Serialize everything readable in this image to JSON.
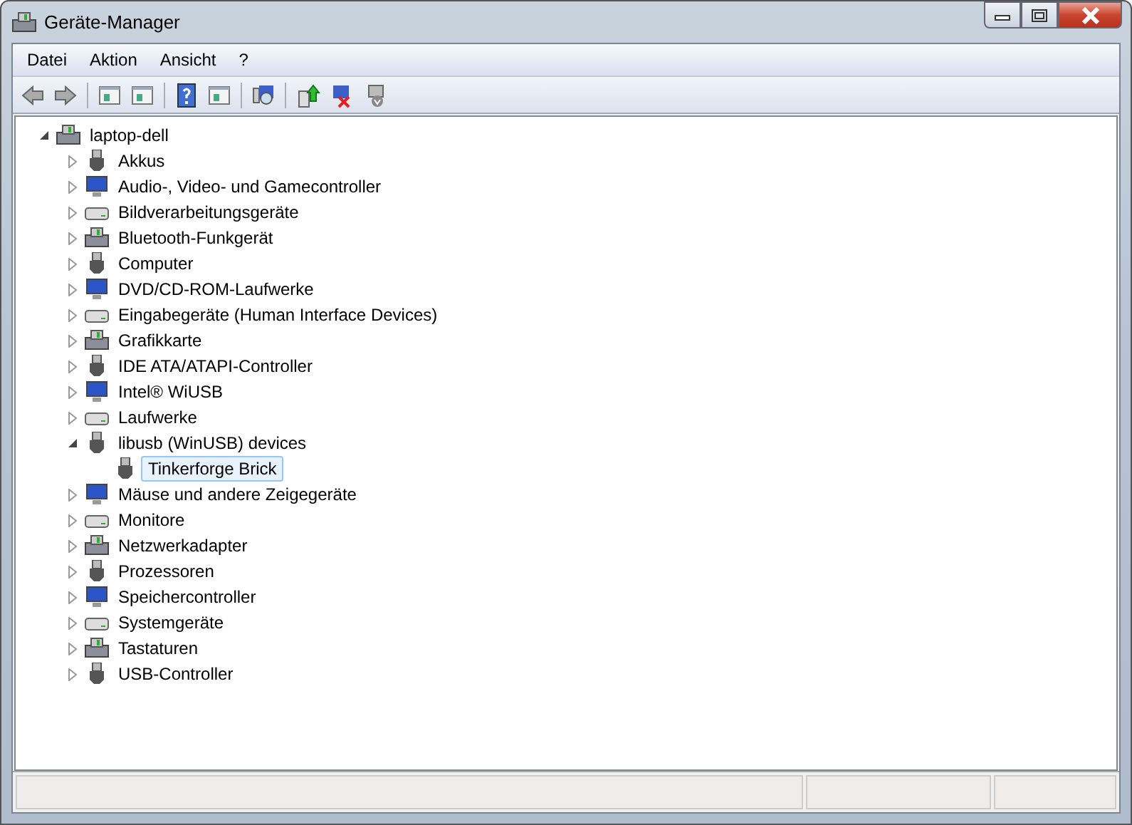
{
  "window": {
    "title": "Geräte-Manager"
  },
  "menu": [
    "Datei",
    "Aktion",
    "Ansicht",
    "?"
  ],
  "tree": [
    {
      "label": "laptop-dell",
      "expanded": true,
      "selected": false,
      "children": [
        {
          "label": "Akkus",
          "expanded": false,
          "selected": false
        },
        {
          "label": "Audio-, Video- und Gamecontroller",
          "expanded": false,
          "selected": false
        },
        {
          "label": "Bildverarbeitungsgeräte",
          "expanded": false,
          "selected": false
        },
        {
          "label": "Bluetooth-Funkgerät",
          "expanded": false,
          "selected": false
        },
        {
          "label": "Computer",
          "expanded": false,
          "selected": false
        },
        {
          "label": "DVD/CD-ROM-Laufwerke",
          "expanded": false,
          "selected": false
        },
        {
          "label": "Eingabegeräte (Human Interface Devices)",
          "expanded": false,
          "selected": false
        },
        {
          "label": "Grafikkarte",
          "expanded": false,
          "selected": false
        },
        {
          "label": "IDE ATA/ATAPI-Controller",
          "expanded": false,
          "selected": false
        },
        {
          "label": "Intel® WiUSB",
          "expanded": false,
          "selected": false
        },
        {
          "label": "Laufwerke",
          "expanded": false,
          "selected": false
        },
        {
          "label": "libusb (WinUSB) devices",
          "expanded": true,
          "selected": false,
          "children": [
            {
              "label": "Tinkerforge Brick",
              "selected": true
            }
          ]
        },
        {
          "label": "Mäuse und andere Zeigegeräte",
          "expanded": false,
          "selected": false
        },
        {
          "label": "Monitore",
          "expanded": false,
          "selected": false
        },
        {
          "label": "Netzwerkadapter",
          "expanded": false,
          "selected": false
        },
        {
          "label": "Prozessoren",
          "expanded": false,
          "selected": false
        },
        {
          "label": "Speichercontroller",
          "expanded": false,
          "selected": false
        },
        {
          "label": "Systemgeräte",
          "expanded": false,
          "selected": false
        },
        {
          "label": "Tastaturen",
          "expanded": false,
          "selected": false
        },
        {
          "label": "USB-Controller",
          "expanded": false,
          "selected": false
        }
      ]
    }
  ]
}
